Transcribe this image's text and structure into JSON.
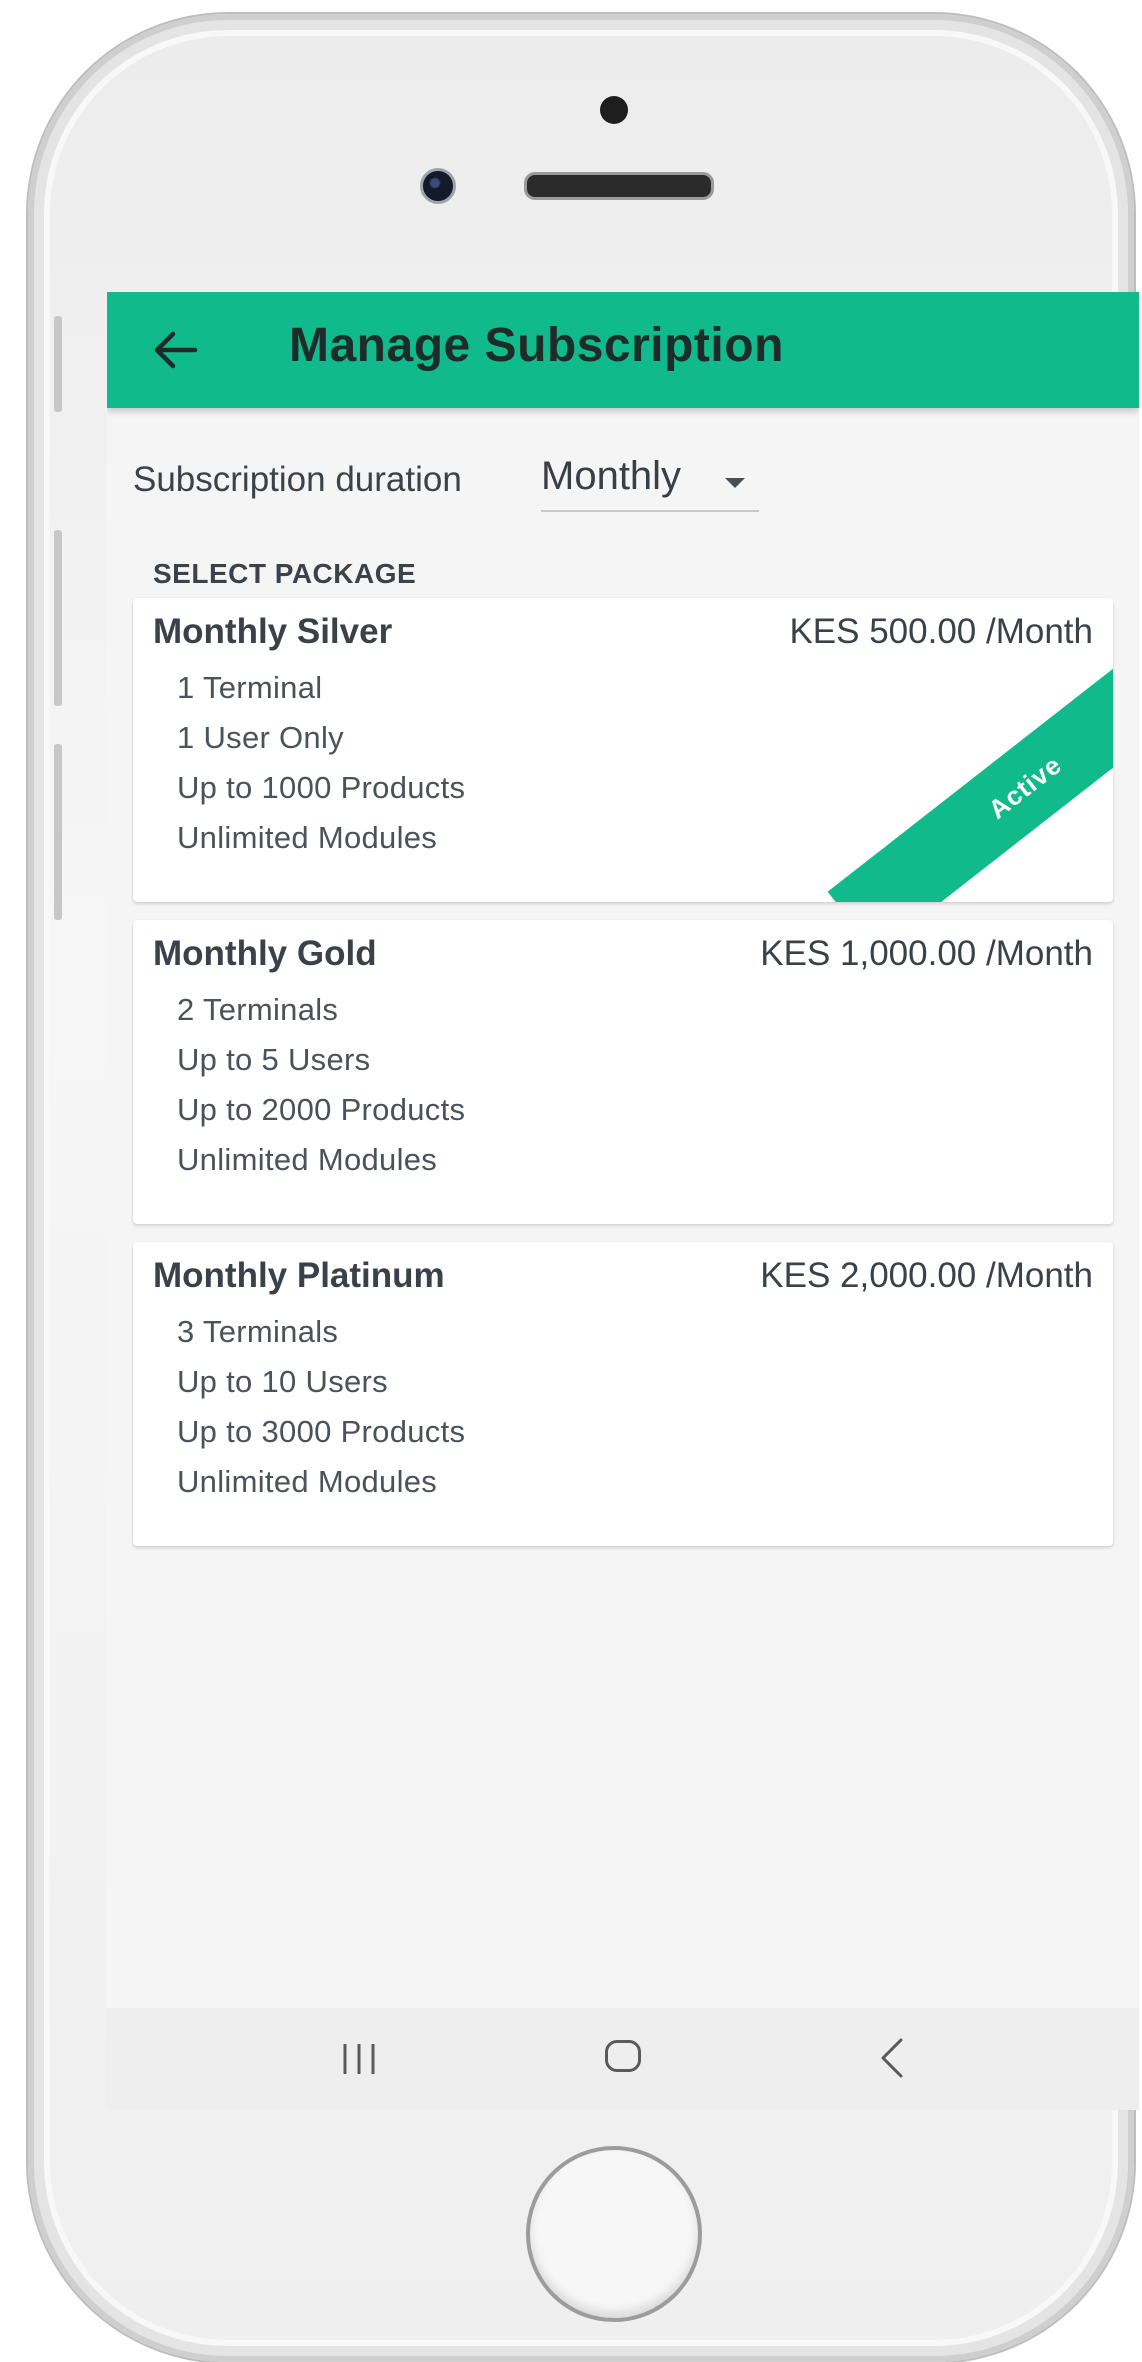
{
  "app_bar": {
    "title": "Manage Subscription"
  },
  "duration": {
    "label": "Subscription duration",
    "value": "Monthly"
  },
  "section_title": "SELECT PACKAGE",
  "packages": [
    {
      "name": "Monthly Silver",
      "price": "KES 500.00 /Month",
      "features": [
        "1 Terminal",
        "1 User Only",
        "Up to 1000 Products",
        "Unlimited Modules"
      ],
      "badge": "Active"
    },
    {
      "name": "Monthly Gold",
      "price": "KES 1,000.00 /Month",
      "features": [
        "2 Terminals",
        "Up to 5 Users",
        "Up to 2000 Products",
        "Unlimited Modules"
      ]
    },
    {
      "name": "Monthly Platinum",
      "price": "KES 2,000.00 /Month",
      "features": [
        "3 Terminals",
        "Up to 10 Users",
        "Up to 3000 Products",
        "Unlimited Modules"
      ]
    }
  ],
  "colors": {
    "accent": "#10ba8b",
    "background": "#f5f5f5",
    "text": "#3a4149"
  },
  "icons": {
    "back": "arrow-left-icon",
    "dropdown": "caret-down-icon",
    "recent_apps": "recent-apps-icon",
    "home": "home-icon",
    "nav_back": "chevron-left-icon"
  }
}
